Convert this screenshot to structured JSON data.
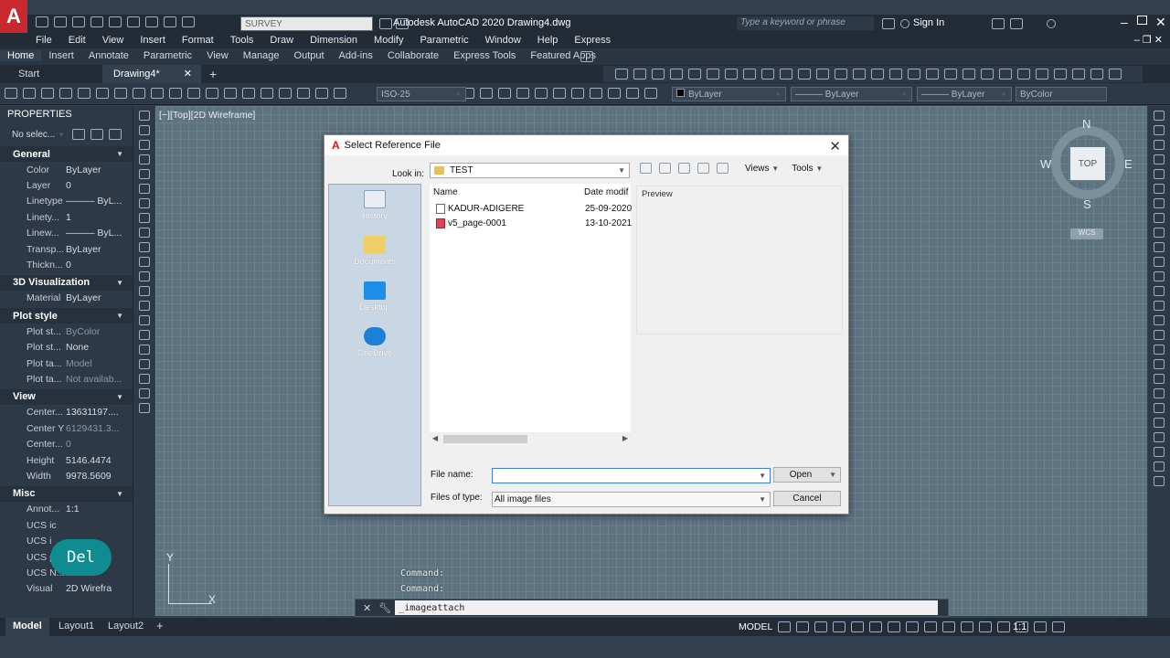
{
  "app": {
    "title": "Autodesk AutoCAD 2020    Drawing4.dwg",
    "workspace": "SURVEY",
    "search_placeholder": "Type a keyword or phrase",
    "sign_in": "Sign In",
    "logo": "A"
  },
  "menu": [
    "File",
    "Edit",
    "View",
    "Insert",
    "Format",
    "Tools",
    "Draw",
    "Dimension",
    "Modify",
    "Parametric",
    "Window",
    "Help",
    "Express"
  ],
  "ribbon_tabs": [
    "Home",
    "Insert",
    "Annotate",
    "Parametric",
    "View",
    "Manage",
    "Output",
    "Add-ins",
    "Collaborate",
    "Express Tools",
    "Featured Apps"
  ],
  "doc_tabs": [
    "Start",
    "Drawing4*"
  ],
  "toolbar": {
    "dimstyle": "ISO-25",
    "color": "ByLayer",
    "linetype": "ByLayer",
    "lineweight": "ByLayer",
    "plotstyle": "ByColor"
  },
  "properties": {
    "title": "PROPERTIES",
    "selection": "No selec...",
    "sections": [
      {
        "name": "General",
        "rows": [
          {
            "k": "Color",
            "v": "ByLayer"
          },
          {
            "k": "Layer",
            "v": "0"
          },
          {
            "k": "Linetype",
            "v": "——— ByL..."
          },
          {
            "k": "Linety...",
            "v": "1"
          },
          {
            "k": "Linew...",
            "v": "——— ByL..."
          },
          {
            "k": "Transp...",
            "v": "ByLayer"
          },
          {
            "k": "Thickn...",
            "v": "0"
          }
        ]
      },
      {
        "name": "3D Visualization",
        "rows": [
          {
            "k": "Material",
            "v": "ByLayer"
          }
        ]
      },
      {
        "name": "Plot style",
        "rows": [
          {
            "k": "Plot st...",
            "v": "ByColor"
          },
          {
            "k": "Plot st...",
            "v": "None"
          },
          {
            "k": "Plot ta...",
            "v": "Model"
          },
          {
            "k": "Plot ta...",
            "v": "Not availab..."
          }
        ]
      },
      {
        "name": "View",
        "rows": [
          {
            "k": "Center...",
            "v": "13631197...."
          },
          {
            "k": "Center Y",
            "v": "6129431.3..."
          },
          {
            "k": "Center...",
            "v": "0"
          },
          {
            "k": "Height",
            "v": "5146.4474"
          },
          {
            "k": "Width",
            "v": "9978.5609"
          }
        ]
      },
      {
        "name": "Misc",
        "rows": [
          {
            "k": "Annot...",
            "v": "1:1"
          },
          {
            "k": "UCS ic",
            "v": ""
          },
          {
            "k": "UCS i",
            "v": ""
          },
          {
            "k": "UCS p",
            "v": ""
          },
          {
            "k": "UCS N...",
            "v": ""
          },
          {
            "k": "Visual",
            "v": "2D Wirefra"
          }
        ]
      }
    ]
  },
  "viewport": {
    "label": "[−][Top][2D Wireframe]",
    "compass": {
      "n": "N",
      "s": "S",
      "e": "E",
      "w": "W",
      "top": "TOP",
      "wcs": "WCS"
    },
    "ucs": {
      "x": "X",
      "y": "Y"
    }
  },
  "command": {
    "history": [
      "Command:",
      "Command:"
    ],
    "input": "_imageattach"
  },
  "overlay_badge": "Del",
  "layouts": [
    "Model",
    "Layout1",
    "Layout2"
  ],
  "status": {
    "model": "MODEL",
    "scale": "1:1"
  },
  "dialog": {
    "title": "Select Reference File",
    "look_in_label": "Look in:",
    "look_in_value": "TEST",
    "views": "Views",
    "tools": "Tools",
    "places": [
      "History",
      "Documents",
      "Desktop",
      "OneDrive"
    ],
    "columns": [
      "Name",
      "Date modif"
    ],
    "files": [
      {
        "name": "KADUR-ADIGERE",
        "date": "25-09-2020"
      },
      {
        "name": "v5_page-0001",
        "date": "13-10-2021"
      }
    ],
    "preview_label": "Preview",
    "file_name_label": "File name:",
    "file_name_value": "",
    "file_type_label": "Files of type:",
    "file_type_value": "All image files",
    "open": "Open",
    "cancel": "Cancel"
  },
  "colors": {
    "accent": "#3c7fd6",
    "canvas": "#5d7380",
    "chrome": "#222b36",
    "logo": "#cc2222"
  }
}
